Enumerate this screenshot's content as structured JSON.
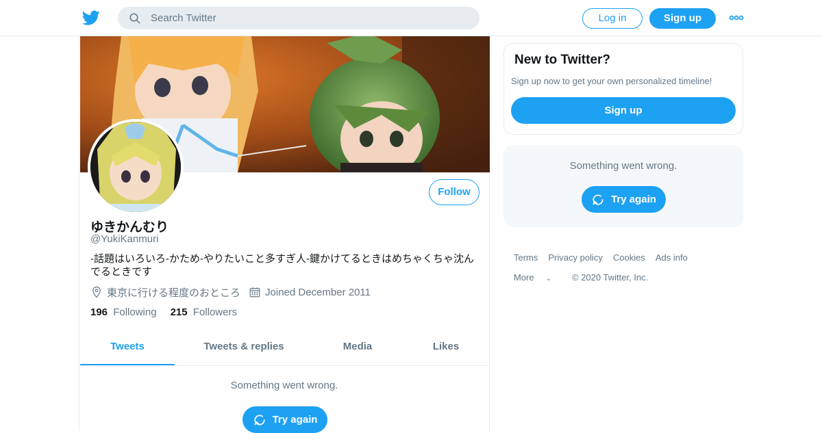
{
  "header": {
    "search_placeholder": "Search Twitter",
    "login_label": "Log in",
    "signup_label": "Sign up",
    "brand_color": "#1da1f2"
  },
  "profile": {
    "display_name": "ゆきかんむり",
    "handle": "@YukiKanmuri",
    "bio": "-話題はいろいろ-かため-やりたいこと多すぎ人-鍵かけてるときはめちゃくちゃ沈んでるときです",
    "location": "東京に行ける程度のおところ",
    "joined": "Joined December 2011",
    "following_count": "196",
    "following_label": "Following",
    "followers_count": "215",
    "followers_label": "Followers",
    "follow_label": "Follow"
  },
  "tabs": [
    {
      "label": "Tweets",
      "active": true
    },
    {
      "label": "Tweets & replies",
      "active": false
    },
    {
      "label": "Media",
      "active": false
    },
    {
      "label": "Likes",
      "active": false
    }
  ],
  "timeline": {
    "error_message": "Something went wrong.",
    "retry_label": "Try again"
  },
  "sidebar": {
    "new_title": "New to Twitter?",
    "new_subtitle": "Sign up now to get your own personalized timeline!",
    "signup_label": "Sign up",
    "error_message": "Something went wrong.",
    "retry_label": "Try again"
  },
  "footer": {
    "links": [
      "Terms",
      "Privacy policy",
      "Cookies",
      "Ads info"
    ],
    "more_label": "More",
    "copyright": "© 2020 Twitter, Inc."
  }
}
